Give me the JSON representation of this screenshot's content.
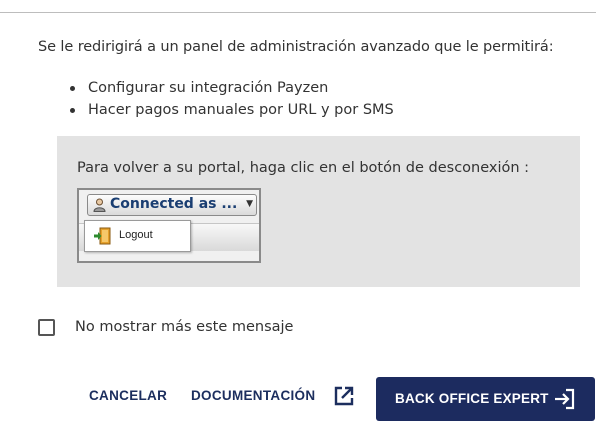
{
  "intro": "Se le redirigirá a un panel de administración avanzado que le permitirá:",
  "bullets": [
    "Configurar su integración Payzen",
    "Hacer pagos manuales por URL y por SMS"
  ],
  "info_box": {
    "text": "Para volver a su portal, haga clic en el botón de desconexión :",
    "legacy_ui": {
      "connected_button_label": "Connected as ...",
      "logout_label": "Logout"
    }
  },
  "checkbox": {
    "label": "No mostrar más este mensaje",
    "checked": false
  },
  "actions": {
    "cancel_label": "CANCELAR",
    "documentation_label": "DOCUMENTACIÓN",
    "primary_label": "BACK OFFICE EXPERT"
  },
  "icons": {
    "documentation": "external-link-icon",
    "primary": "sign-in-icon",
    "user": "user-icon",
    "logout": "door-exit-icon"
  },
  "colors": {
    "primary": "#1c2b5f",
    "text": "#333333",
    "box_bg": "#e3e3e3"
  }
}
